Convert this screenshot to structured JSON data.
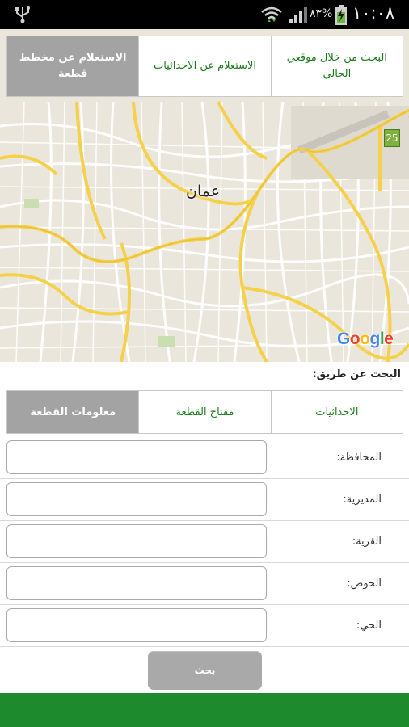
{
  "status_bar": {
    "battery_percent": "٨٣%",
    "clock": "١٠:٠٨"
  },
  "map": {
    "city_label": "عمان",
    "route_number": "25",
    "google_logo": "Google",
    "top_tabs": [
      {
        "label": "البحث من خلال موقعي الحالي",
        "active": false
      },
      {
        "label": "الاستعلام عن الاحداثيات",
        "active": false
      },
      {
        "label": "الاستعلام عن مخطط قطعة",
        "active": true
      }
    ]
  },
  "search": {
    "search_by_label": "البحث عن طريق:",
    "tabs": [
      {
        "label": "الاحداثيات",
        "active": false
      },
      {
        "label": "مفتاح القطعة",
        "active": false
      },
      {
        "label": "معلومات القطعة",
        "active": true
      }
    ],
    "fields": [
      {
        "label": "المحافظة:",
        "value": "",
        "placeholder": ""
      },
      {
        "label": "المديرية:",
        "value": "",
        "placeholder": ""
      },
      {
        "label": "القرية:",
        "value": "",
        "placeholder": ""
      },
      {
        "label": "الحوض:",
        "value": "",
        "placeholder": ""
      },
      {
        "label": "الحي:",
        "value": "",
        "placeholder": ""
      }
    ],
    "submit_label": "بحث"
  },
  "colors": {
    "accent_green": "#1e8a2e",
    "tab_active_bg": "#a3a3a3",
    "tab_text_green": "#1c7a1c"
  }
}
